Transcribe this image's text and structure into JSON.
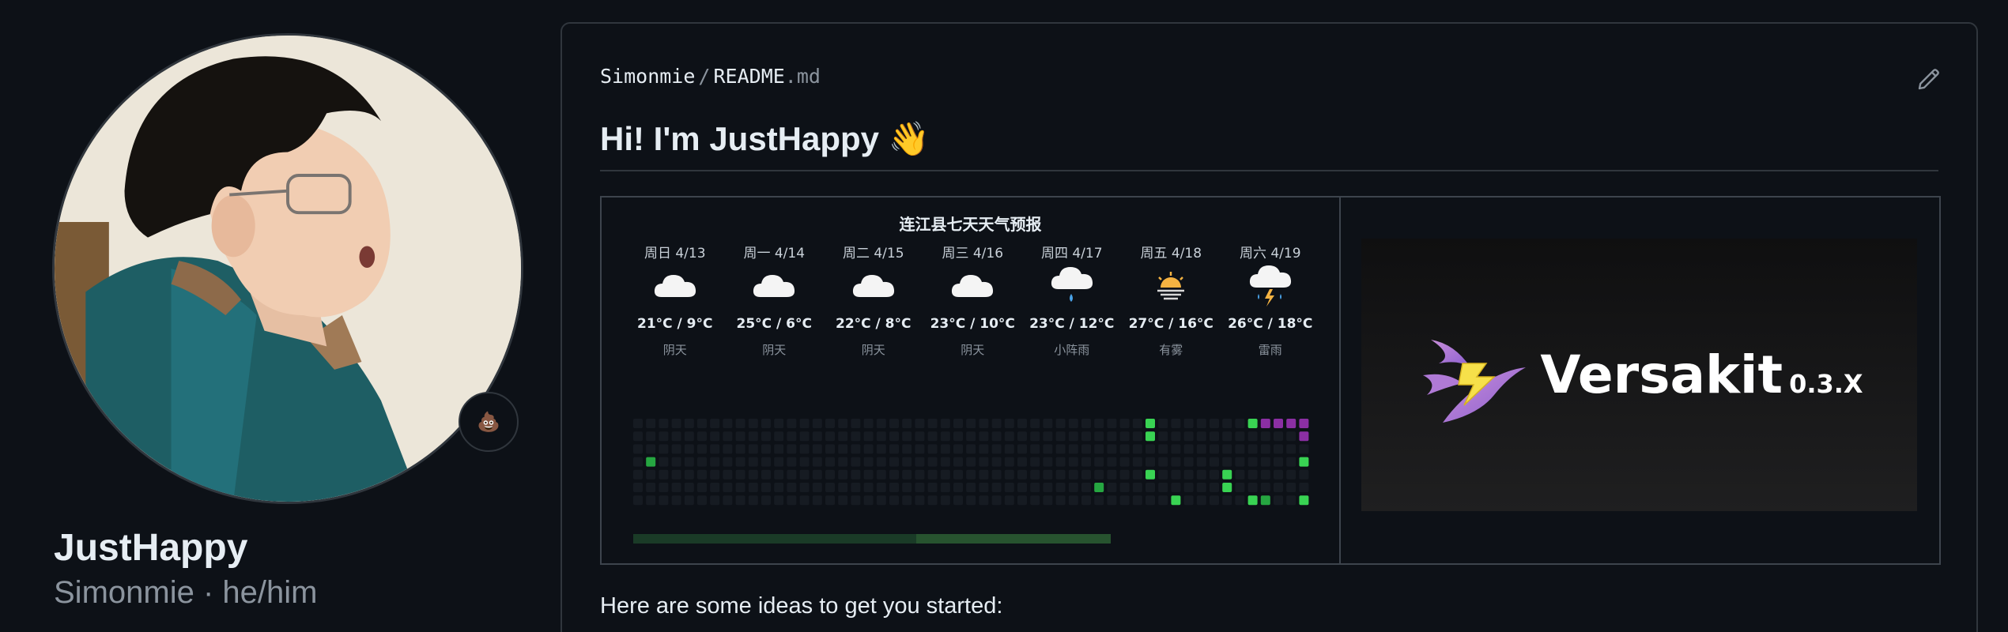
{
  "profile": {
    "full_name": "JustHappy",
    "subtitle": "Simonmie · he/him",
    "status_emoji": "💩"
  },
  "readme": {
    "owner": "Simonmie",
    "separator": "/",
    "file_base": "README",
    "file_ext": ".md",
    "title": "Hi! I'm JustHappy 👋",
    "ideas_text": "Here are some ideas to get you started:",
    "edit_icon": "pencil-icon"
  },
  "weather": {
    "title": "连江县七天天气预报",
    "days": [
      {
        "date": "周日 4/13",
        "icon": "cloud",
        "temp": "21°C / 9°C",
        "cond": "阴天"
      },
      {
        "date": "周一 4/14",
        "icon": "cloud",
        "temp": "25°C / 6°C",
        "cond": "阴天"
      },
      {
        "date": "周二 4/15",
        "icon": "cloud",
        "temp": "22°C / 8°C",
        "cond": "阴天"
      },
      {
        "date": "周三 4/16",
        "icon": "cloud",
        "temp": "23°C / 10°C",
        "cond": "阴天"
      },
      {
        "date": "周四 4/17",
        "icon": "rain-cloud",
        "temp": "23°C / 12°C",
        "cond": "小阵雨"
      },
      {
        "date": "周五 4/18",
        "icon": "sunrise",
        "temp": "27°C / 16°C",
        "cond": "有雾"
      },
      {
        "date": "周六 4/19",
        "icon": "storm-cloud",
        "temp": "26°C / 18°C",
        "cond": "雷雨"
      }
    ]
  },
  "banner": {
    "name": "Versakit",
    "version": "0.3.X",
    "logo_icon": "hummingbird-lightning-icon"
  },
  "colors": {
    "background": "#0d1117",
    "border": "#30363d",
    "text": "#e6edf3",
    "muted": "#8b949e",
    "contrib_empty": "#161b22",
    "contrib_green": "#39d353",
    "contrib_dark_green": "#26a641",
    "contrib_purple": "#8b2fa3"
  }
}
